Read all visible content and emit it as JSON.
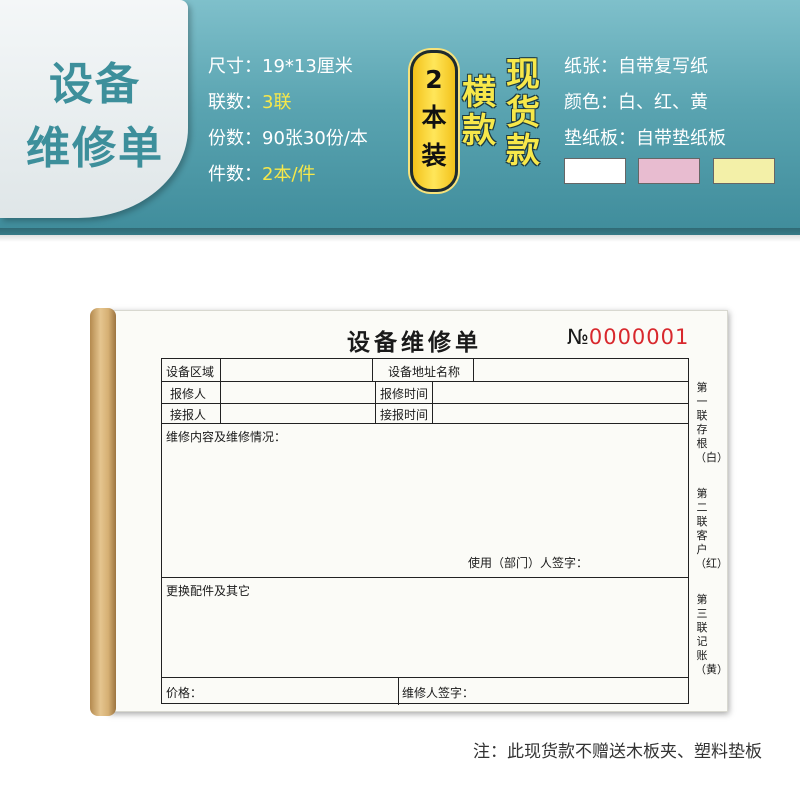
{
  "banner": {
    "title_line1": "设备",
    "title_line2": "维修单",
    "specs": [
      {
        "label": "尺寸：",
        "value": "19*13厘米",
        "highlight": false
      },
      {
        "label": "联数：",
        "value": "3联",
        "highlight": true
      },
      {
        "label": "份数：",
        "value": "90张30份/本",
        "highlight": false
      },
      {
        "label": "件数：",
        "value": "2本/件",
        "highlight": true
      }
    ],
    "badge": "2本装",
    "vertical_text_1": "横款",
    "vertical_text_2": "现货款",
    "paper_specs": [
      {
        "label": "纸张：",
        "value": "自带复写纸"
      },
      {
        "label": "颜色：",
        "value": "白、红、黄"
      },
      {
        "label": "垫纸板：",
        "value": "自带垫纸板"
      }
    ],
    "swatch_colors": [
      "#ffffff",
      "#e8bcd0",
      "#f3f0a8"
    ]
  },
  "form": {
    "title": "设备维修单",
    "number_symbol": "№",
    "number": "0000001",
    "fields": {
      "area": "设备区域",
      "address": "设备地址名称",
      "reporter": "报修人",
      "report_time": "报修时间",
      "receiver": "接报人",
      "receive_time": "接报时间",
      "content": "维修内容及维修情况：",
      "signature": "使用（部门）人签字：",
      "parts": "更换配件及其它",
      "price": "价格：",
      "repairer_signature": "维修人签字："
    },
    "side_notes": [
      "第一联存根（白）",
      "第二联客户（红）",
      "第三联记账（黄）"
    ]
  },
  "footer_note": "注：此现货款不赠送木板夹、塑料垫板"
}
